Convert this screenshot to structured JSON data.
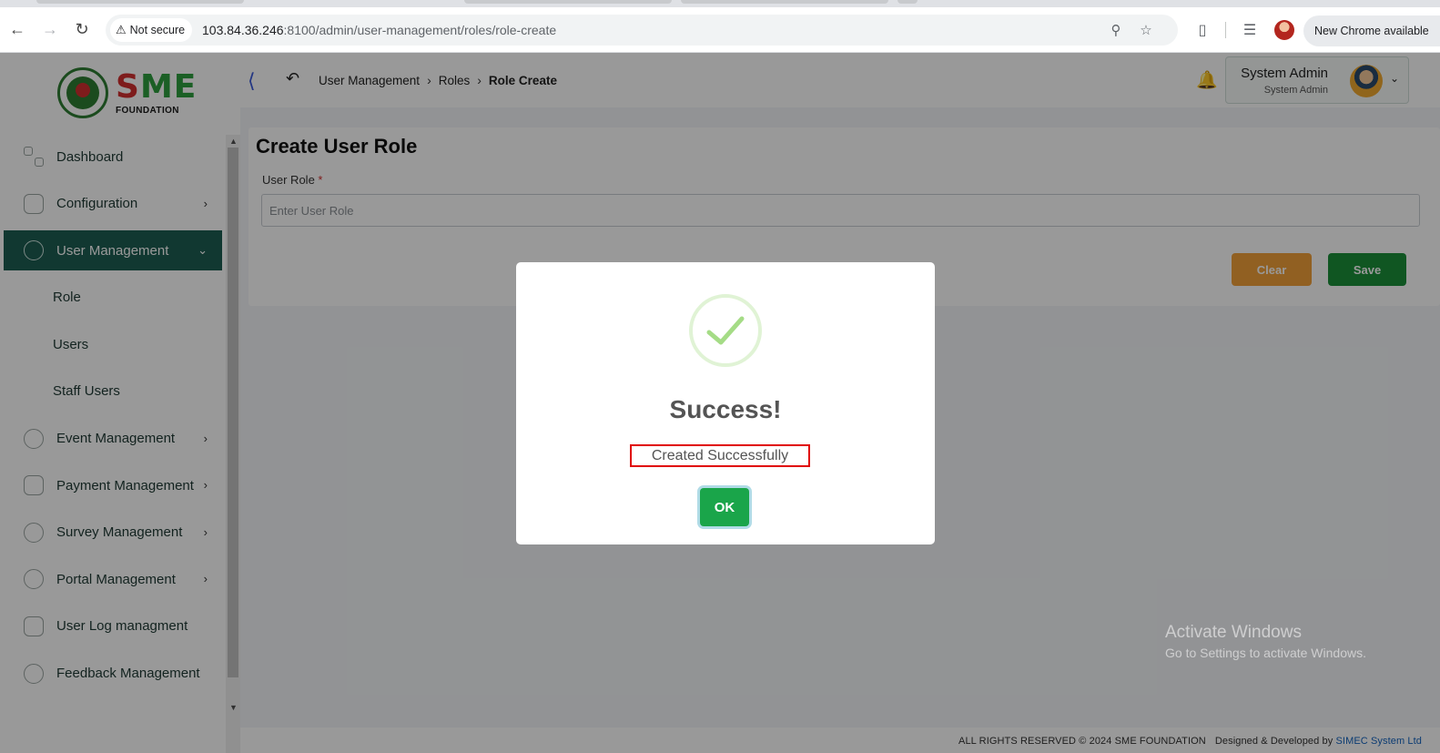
{
  "browser": {
    "security_label": "Not secure",
    "url_host": "103.84.36.246",
    "url_rest": ":8100/admin/user-management/roles/role-create",
    "update_label": "New Chrome available"
  },
  "logo": {
    "brand_s": "S",
    "brand_rest": "ME",
    "brand_sub": "FOUNDATION"
  },
  "sidebar": {
    "items": [
      {
        "label": "Dashboard"
      },
      {
        "label": "Configuration"
      },
      {
        "label": "User Management"
      },
      {
        "label": "Role"
      },
      {
        "label": "Users"
      },
      {
        "label": "Staff Users"
      },
      {
        "label": "Event Management"
      },
      {
        "label": "Payment Management"
      },
      {
        "label": "Survey Management"
      },
      {
        "label": "Portal Management"
      },
      {
        "label": "User Log managment"
      },
      {
        "label": "Feedback Management"
      }
    ]
  },
  "breadcrumb": {
    "items": [
      "User Management",
      "Roles",
      "Role Create"
    ]
  },
  "user": {
    "name": "System Admin",
    "role": "System Admin"
  },
  "page": {
    "title": "Create User Role",
    "field_label": "User Role",
    "required_mark": "*",
    "placeholder": "Enter User Role",
    "clear_label": "Clear",
    "save_label": "Save"
  },
  "footer": {
    "rights": "ALL RIGHTS RESERVED © 2024 SME FOUNDATION",
    "designed": "Designed & Developed by",
    "company": "SIMEC System Ltd"
  },
  "watermark": {
    "title": "Activate Windows",
    "subtitle": "Go to Settings to activate Windows."
  },
  "dialog": {
    "title": "Success!",
    "message": "Created Successfully",
    "ok_label": "OK"
  },
  "colors": {
    "sidebar_active": "#1d5e52",
    "clear_button": "#f2a03a",
    "save_button": "#1b8f3a",
    "ok_button": "#1aa54a",
    "highlight_box": "#e00000"
  }
}
